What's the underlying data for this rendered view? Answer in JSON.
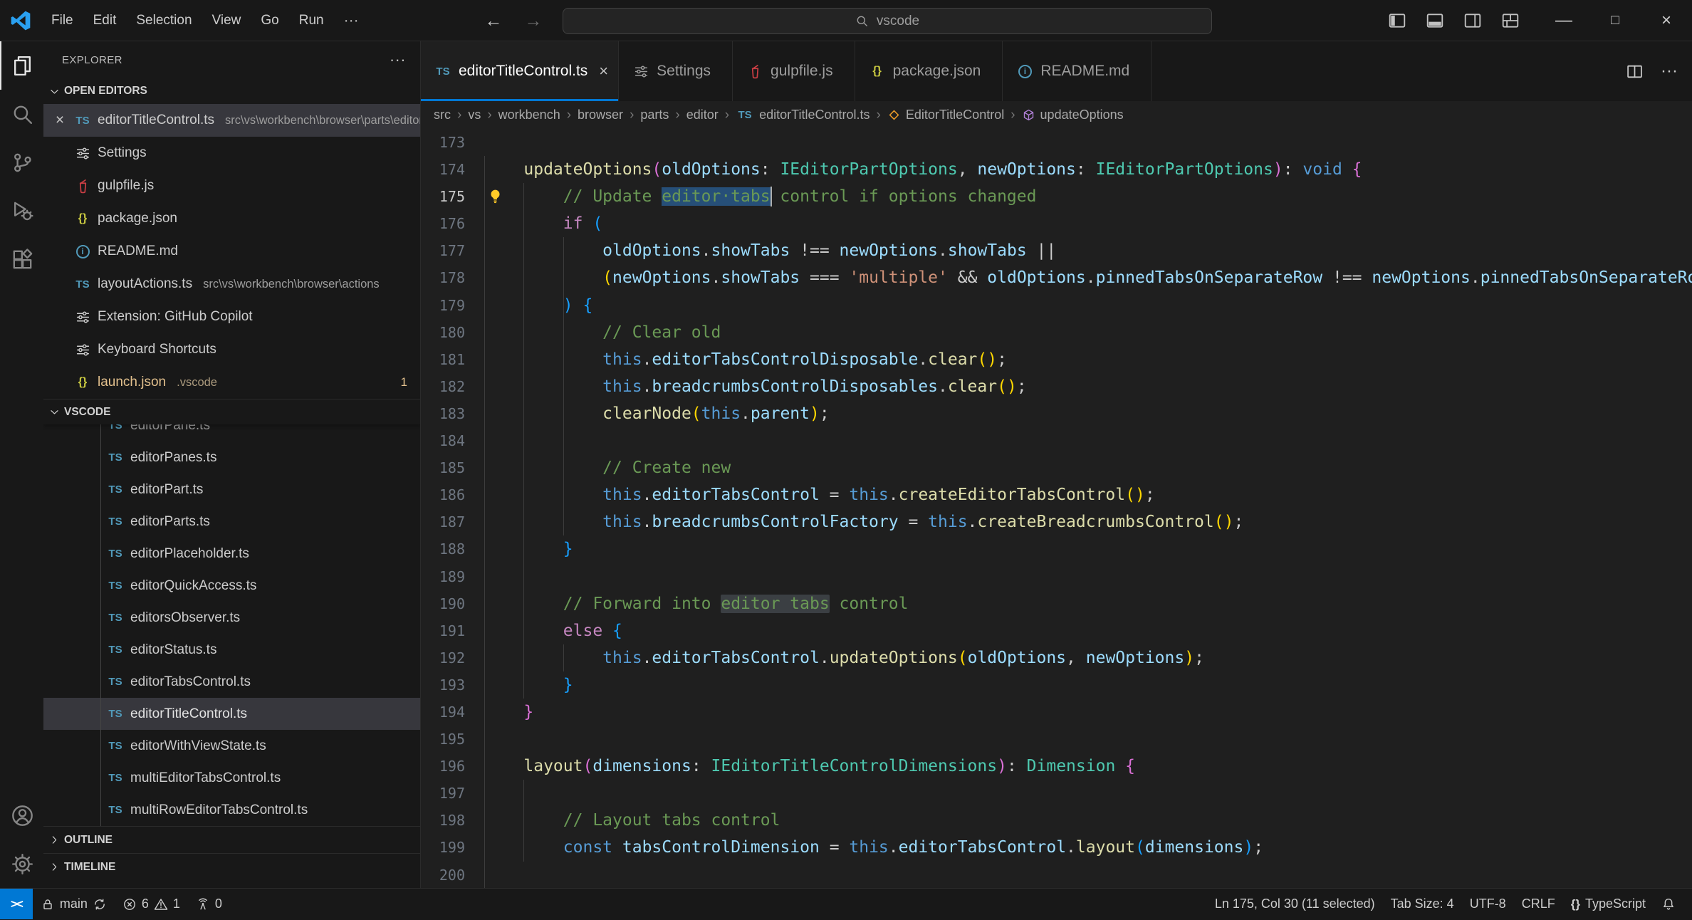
{
  "titleBar": {
    "menus": [
      "File",
      "Edit",
      "Selection",
      "View",
      "Go",
      "Run"
    ],
    "overflow": "···",
    "back": "←",
    "forward": "→",
    "search": {
      "value": "vscode",
      "icon": "search-small"
    },
    "layout": [
      "layout-sidebar-left",
      "layout-panel",
      "layout-sidebar-right",
      "layout-grid"
    ],
    "window": {
      "minimize": "—",
      "maximize": "□",
      "close": "×"
    }
  },
  "activityBar": {
    "top": [
      {
        "name": "explorer",
        "active": true
      },
      {
        "name": "search",
        "active": false
      },
      {
        "name": "source-control",
        "active": false
      },
      {
        "name": "run-debug",
        "active": false
      },
      {
        "name": "extensions",
        "active": false
      }
    ],
    "bottom": [
      {
        "name": "accounts"
      },
      {
        "name": "settings-gear"
      }
    ]
  },
  "sidebar": {
    "title": "EXPLORER",
    "titleMore": "···",
    "openEditors": {
      "label": "OPEN EDITORS",
      "items": [
        {
          "icon": "ts",
          "name": "editorTitleControl.ts",
          "desc": "src\\vs\\workbench\\browser\\parts\\editor",
          "active": true,
          "close": "×"
        },
        {
          "icon": "tune",
          "name": "Settings"
        },
        {
          "icon": "gulp",
          "name": "gulpfile.js"
        },
        {
          "icon": "json",
          "name": "package.json"
        },
        {
          "icon": "md",
          "name": "README.md"
        },
        {
          "icon": "ts",
          "name": "layoutActions.ts",
          "desc": "src\\vs\\workbench\\browser\\actions"
        },
        {
          "icon": "tune",
          "name": "Extension: GitHub Copilot"
        },
        {
          "icon": "tune",
          "name": "Keyboard Shortcuts"
        },
        {
          "icon": "json",
          "name": "launch.json",
          "desc": ".vscode",
          "modified": true,
          "badge": "1"
        }
      ]
    },
    "tree": {
      "label": "VSCODE",
      "partialItem": {
        "icon": "ts",
        "name": "editorPane.ts"
      },
      "items": [
        {
          "icon": "ts",
          "name": "editorPanes.ts"
        },
        {
          "icon": "ts",
          "name": "editorPart.ts"
        },
        {
          "icon": "ts",
          "name": "editorParts.ts"
        },
        {
          "icon": "ts",
          "name": "editorPlaceholder.ts"
        },
        {
          "icon": "ts",
          "name": "editorQuickAccess.ts"
        },
        {
          "icon": "ts",
          "name": "editorsObserver.ts"
        },
        {
          "icon": "ts",
          "name": "editorStatus.ts"
        },
        {
          "icon": "ts",
          "name": "editorTabsControl.ts"
        },
        {
          "icon": "ts",
          "name": "editorTitleControl.ts",
          "selected": true
        },
        {
          "icon": "ts",
          "name": "editorWithViewState.ts"
        },
        {
          "icon": "ts",
          "name": "multiEditorTabsControl.ts"
        },
        {
          "icon": "ts",
          "name": "multiRowEditorTabsControl.ts"
        }
      ]
    },
    "outline": {
      "label": "OUTLINE"
    },
    "timeline": {
      "label": "TIMELINE"
    }
  },
  "editor": {
    "tabs": [
      {
        "icon": "ts",
        "label": "editorTitleControl.ts",
        "active": true
      },
      {
        "icon": "tune",
        "label": "Settings"
      },
      {
        "icon": "gulp",
        "label": "gulpfile.js"
      },
      {
        "icon": "json",
        "label": "package.json"
      },
      {
        "icon": "md",
        "label": "README.md"
      }
    ],
    "actions": [
      {
        "icon": "split-editor",
        "name": "split-editor-button"
      },
      {
        "text": "···",
        "name": "editor-more-actions"
      }
    ],
    "breadcrumbs": [
      {
        "label": "src"
      },
      {
        "label": "vs"
      },
      {
        "label": "workbench"
      },
      {
        "label": "browser"
      },
      {
        "label": "parts"
      },
      {
        "label": "editor"
      },
      {
        "icon": "ts",
        "label": "editorTitleControl.ts"
      },
      {
        "icon": "class",
        "label": "EditorTitleControl"
      },
      {
        "icon": "method",
        "label": "updateOptions"
      }
    ],
    "code": {
      "cursor": {
        "line": 175,
        "col": 30
      },
      "lines": [
        {
          "num": 173,
          "tokens": []
        },
        {
          "num": 174,
          "tokens": [
            [
              "pn",
              "    "
            ],
            [
              "fn",
              "updateOptions"
            ],
            [
              "b2",
              "("
            ],
            [
              "var",
              "oldOptions"
            ],
            [
              "pn",
              ": "
            ],
            [
              "type",
              "IEditorPartOptions"
            ],
            [
              "pn",
              ", "
            ],
            [
              "var",
              "newOptions"
            ],
            [
              "pn",
              ": "
            ],
            [
              "type",
              "IEditorPartOptions"
            ],
            [
              "b2",
              ")"
            ],
            [
              "pn",
              ": "
            ],
            [
              "kw",
              "void"
            ],
            [
              "pn",
              " "
            ],
            [
              "b2",
              "{"
            ]
          ]
        },
        {
          "num": 175,
          "lightbulb": true,
          "tokens": [
            [
              "com",
              "        // Update "
            ],
            [
              "com sel",
              "editor·tabs"
            ],
            [
              "com",
              " control if options changed"
            ]
          ]
        },
        {
          "num": 176,
          "tokens": [
            [
              "pn",
              "        "
            ],
            [
              "ctrl",
              "if"
            ],
            [
              "pn",
              " "
            ],
            [
              "b3",
              "("
            ]
          ]
        },
        {
          "num": 177,
          "tokens": [
            [
              "pn",
              "            "
            ],
            [
              "var",
              "oldOptions"
            ],
            [
              "pn",
              "."
            ],
            [
              "var",
              "showTabs"
            ],
            [
              "pn",
              " !== "
            ],
            [
              "var",
              "newOptions"
            ],
            [
              "pn",
              "."
            ],
            [
              "var",
              "showTabs"
            ],
            [
              "pn",
              " ||"
            ]
          ]
        },
        {
          "num": 178,
          "tokens": [
            [
              "pn",
              "            "
            ],
            [
              "b1",
              "("
            ],
            [
              "var",
              "newOptions"
            ],
            [
              "pn",
              "."
            ],
            [
              "var",
              "showTabs"
            ],
            [
              "pn",
              " === "
            ],
            [
              "str",
              "'multiple'"
            ],
            [
              "pn",
              " && "
            ],
            [
              "var",
              "oldOptions"
            ],
            [
              "pn",
              "."
            ],
            [
              "var",
              "pinnedTabsOnSeparateRow"
            ],
            [
              "pn",
              " !== "
            ],
            [
              "var",
              "newOptions"
            ],
            [
              "pn",
              "."
            ],
            [
              "var",
              "pinnedTabsOnSeparateRow"
            ],
            [
              "b1",
              ")"
            ]
          ]
        },
        {
          "num": 179,
          "tokens": [
            [
              "pn",
              "        "
            ],
            [
              "b3",
              ")"
            ],
            [
              "pn",
              " "
            ],
            [
              "b3",
              "{"
            ]
          ]
        },
        {
          "num": 180,
          "tokens": [
            [
              "com",
              "            // Clear old"
            ]
          ]
        },
        {
          "num": 181,
          "tokens": [
            [
              "pn",
              "            "
            ],
            [
              "kw",
              "this"
            ],
            [
              "pn",
              "."
            ],
            [
              "var",
              "editorTabsControlDisposable"
            ],
            [
              "pn",
              "."
            ],
            [
              "fn",
              "clear"
            ],
            [
              "b1",
              "()"
            ],
            [
              "pn",
              ";"
            ]
          ]
        },
        {
          "num": 182,
          "tokens": [
            [
              "pn",
              "            "
            ],
            [
              "kw",
              "this"
            ],
            [
              "pn",
              "."
            ],
            [
              "var",
              "breadcrumbsControlDisposables"
            ],
            [
              "pn",
              "."
            ],
            [
              "fn",
              "clear"
            ],
            [
              "b1",
              "()"
            ],
            [
              "pn",
              ";"
            ]
          ]
        },
        {
          "num": 183,
          "tokens": [
            [
              "pn",
              "            "
            ],
            [
              "fn",
              "clearNode"
            ],
            [
              "b1",
              "("
            ],
            [
              "kw",
              "this"
            ],
            [
              "pn",
              "."
            ],
            [
              "var",
              "parent"
            ],
            [
              "b1",
              ")"
            ],
            [
              "pn",
              ";"
            ]
          ]
        },
        {
          "num": 184,
          "tokens": []
        },
        {
          "num": 185,
          "tokens": [
            [
              "com",
              "            // Create new"
            ]
          ]
        },
        {
          "num": 186,
          "tokens": [
            [
              "pn",
              "            "
            ],
            [
              "kw",
              "this"
            ],
            [
              "pn",
              "."
            ],
            [
              "var",
              "editorTabsControl"
            ],
            [
              "pn",
              " = "
            ],
            [
              "kw",
              "this"
            ],
            [
              "pn",
              "."
            ],
            [
              "fn",
              "createEditorTabsControl"
            ],
            [
              "b1",
              "()"
            ],
            [
              "pn",
              ";"
            ]
          ]
        },
        {
          "num": 187,
          "tokens": [
            [
              "pn",
              "            "
            ],
            [
              "kw",
              "this"
            ],
            [
              "pn",
              "."
            ],
            [
              "var",
              "breadcrumbsControlFactory"
            ],
            [
              "pn",
              " = "
            ],
            [
              "kw",
              "this"
            ],
            [
              "pn",
              "."
            ],
            [
              "fn",
              "createBreadcrumbsControl"
            ],
            [
              "b1",
              "()"
            ],
            [
              "pn",
              ";"
            ]
          ]
        },
        {
          "num": 188,
          "tokens": [
            [
              "pn",
              "        "
            ],
            [
              "b3",
              "}"
            ]
          ]
        },
        {
          "num": 189,
          "tokens": []
        },
        {
          "num": 190,
          "tokens": [
            [
              "com",
              "        // Forward into "
            ],
            [
              "com occ",
              "editor tabs"
            ],
            [
              "com",
              " control"
            ]
          ]
        },
        {
          "num": 191,
          "tokens": [
            [
              "pn",
              "        "
            ],
            [
              "ctrl",
              "else"
            ],
            [
              "pn",
              " "
            ],
            [
              "b3",
              "{"
            ]
          ]
        },
        {
          "num": 192,
          "tokens": [
            [
              "pn",
              "            "
            ],
            [
              "kw",
              "this"
            ],
            [
              "pn",
              "."
            ],
            [
              "var",
              "editorTabsControl"
            ],
            [
              "pn",
              "."
            ],
            [
              "fn",
              "updateOptions"
            ],
            [
              "b1",
              "("
            ],
            [
              "var",
              "oldOptions"
            ],
            [
              "pn",
              ", "
            ],
            [
              "var",
              "newOptions"
            ],
            [
              "b1",
              ")"
            ],
            [
              "pn",
              ";"
            ]
          ]
        },
        {
          "num": 193,
          "tokens": [
            [
              "pn",
              "        "
            ],
            [
              "b3",
              "}"
            ]
          ]
        },
        {
          "num": 194,
          "tokens": [
            [
              "pn",
              "    "
            ],
            [
              "b2",
              "}"
            ]
          ]
        },
        {
          "num": 195,
          "tokens": []
        },
        {
          "num": 196,
          "tokens": [
            [
              "pn",
              "    "
            ],
            [
              "fn",
              "layout"
            ],
            [
              "b2",
              "("
            ],
            [
              "var",
              "dimensions"
            ],
            [
              "pn",
              ": "
            ],
            [
              "type",
              "IEditorTitleControlDimensions"
            ],
            [
              "b2",
              ")"
            ],
            [
              "pn",
              ": "
            ],
            [
              "type",
              "Dimension"
            ],
            [
              "pn",
              " "
            ],
            [
              "b2",
              "{"
            ]
          ]
        },
        {
          "num": 197,
          "tokens": []
        },
        {
          "num": 198,
          "tokens": [
            [
              "com",
              "        // Layout tabs control"
            ]
          ]
        },
        {
          "num": 199,
          "tokens": [
            [
              "pn",
              "        "
            ],
            [
              "kw",
              "const"
            ],
            [
              "pn",
              " "
            ],
            [
              "var",
              "tabsControlDimension"
            ],
            [
              "pn",
              " = "
            ],
            [
              "kw",
              "this"
            ],
            [
              "pn",
              "."
            ],
            [
              "var",
              "editorTabsControl"
            ],
            [
              "pn",
              "."
            ],
            [
              "fn",
              "layout"
            ],
            [
              "b3",
              "("
            ],
            [
              "var",
              "dimensions"
            ],
            [
              "b3",
              ")"
            ],
            [
              "pn",
              ";"
            ]
          ]
        },
        {
          "num": 200,
          "tokens": []
        }
      ]
    }
  },
  "statusBar": {
    "remote": {
      "glyph": "><"
    },
    "left": [
      {
        "name": "branch-status",
        "parts": [
          {
            "icon": "lock"
          },
          {
            "text": "main"
          },
          {
            "icon": "sync"
          }
        ]
      },
      {
        "name": "problems-status",
        "parts": [
          {
            "icon": "error"
          },
          {
            "text": "6"
          },
          {
            "icon": "warning"
          },
          {
            "text": "1"
          }
        ]
      },
      {
        "name": "ports-status",
        "parts": [
          {
            "icon": "broadcast"
          },
          {
            "text": "0"
          }
        ]
      }
    ],
    "right": [
      {
        "name": "cursor-position",
        "text": "Ln 175, Col 30 (11 selected)"
      },
      {
        "name": "indentation",
        "text": "Tab Size: 4"
      },
      {
        "name": "encoding",
        "text": "UTF-8"
      },
      {
        "name": "eol",
        "text": "CRLF"
      },
      {
        "name": "language-mode",
        "parts": [
          {
            "icon": "braces"
          },
          {
            "text": "TypeScript"
          }
        ]
      },
      {
        "name": "notifications",
        "parts": [
          {
            "icon": "bell"
          }
        ]
      }
    ]
  }
}
